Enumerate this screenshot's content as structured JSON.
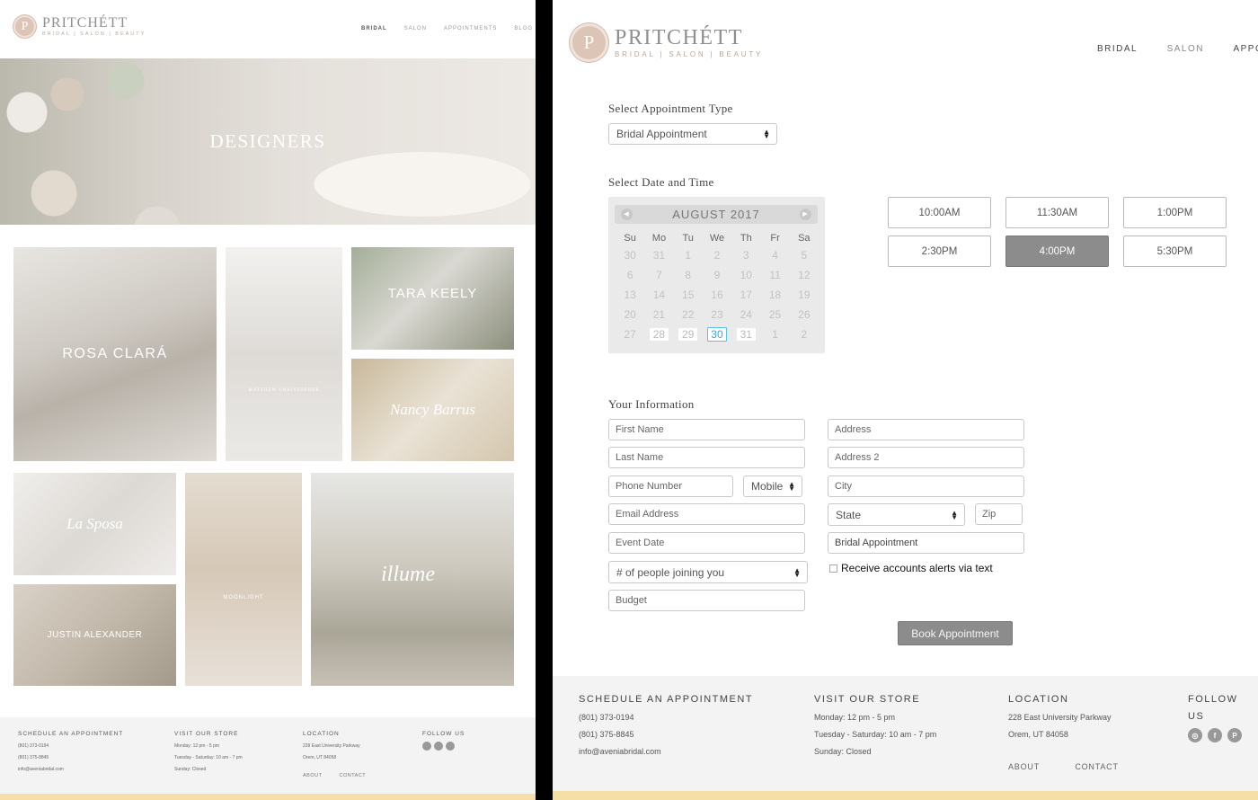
{
  "brand": {
    "monogram": "P",
    "name": "PRITCHÉTT",
    "tagline": "BRIDAL | SALON | BEAUTY"
  },
  "left": {
    "nav": [
      "BRIDAL",
      "SALON",
      "APPOINTMENTS",
      "BLOG"
    ],
    "hero_title": "DESIGNERS",
    "designers": [
      "ROSA CLARÁ",
      "MATTHEW CHRISTOPHER",
      "TARA KEELY",
      "Nancy Barrus",
      "La Sposa",
      "MOONLIGHT",
      "illume",
      "JUSTIN ALEXANDER"
    ],
    "footer": {
      "schedule_title": "SCHEDULE AN APPOINTMENT",
      "phone1": "(801) 373-0194",
      "phone2": "(801) 375-8845",
      "email": "info@aveniabridal.com",
      "store_title": "VISIT OUR STORE",
      "hours1": "Monday: 12 pm - 5 pm",
      "hours2": "Tuesday - Saturday: 10 am - 7 pm",
      "hours3": "Sunday: Closed",
      "location_title": "LOCATION",
      "address1": "228 East University Parkway",
      "address2": "Orem, UT 84058",
      "follow_title": "FOLLOW US",
      "about": "ABOUT",
      "contact": "CONTACT"
    }
  },
  "right": {
    "nav": [
      "BRIDAL",
      "SALON",
      "APPOINTMENTS"
    ],
    "appointment_type_heading": "Select Appointment Type",
    "appointment_type_value": "Bridal Appointment",
    "date_time_heading": "Select Date and Time",
    "calendar": {
      "month": "AUGUST 2017",
      "prev": "◀",
      "next": "▶",
      "dow": [
        "Su",
        "Mo",
        "Tu",
        "We",
        "Th",
        "Fr",
        "Sa"
      ],
      "weeks": [
        [
          "30",
          "31",
          "1",
          "2",
          "3",
          "4",
          "5"
        ],
        [
          "6",
          "7",
          "8",
          "9",
          "10",
          "11",
          "12"
        ],
        [
          "13",
          "14",
          "15",
          "16",
          "17",
          "18",
          "19"
        ],
        [
          "20",
          "21",
          "22",
          "23",
          "24",
          "25",
          "26"
        ],
        [
          "27",
          "28",
          "29",
          "30",
          "31",
          "1",
          "2"
        ]
      ],
      "selected_day": "30"
    },
    "time_slots": [
      "10:00AM",
      "11:30AM",
      "1:00PM",
      "2:30PM",
      "4:00PM",
      "5:30PM"
    ],
    "selected_slot": "4:00PM",
    "info_heading": "Your Information",
    "fields": {
      "first_name": "First Name",
      "last_name": "Last Name",
      "phone": "Phone Number",
      "phone_type": "Mobile",
      "email": "Email Address",
      "event_date": "Event Date",
      "people": "# of people joining you",
      "budget": "Budget",
      "address": "Address",
      "address2": "Address 2",
      "city": "City",
      "state": "State",
      "zip": "Zip",
      "appointment": "Bridal Appointment"
    },
    "alerts_label": "Receive accounts alerts via text",
    "book_button": "Book Appointment",
    "footer": {
      "schedule_title": "SCHEDULE AN APPOINTMENT",
      "phone1": "(801) 373-0194",
      "phone2": "(801) 375-8845",
      "email": "info@aveniabridal.com",
      "store_title": "VISIT OUR STORE",
      "hours1": "Monday: 12 pm - 5 pm",
      "hours2": "Tuesday - Saturday: 10 am - 7 pm",
      "hours3": "Sunday: Closed",
      "location_title": "LOCATION",
      "address1": "228 East University Parkway",
      "address2": "Orem, UT 84058",
      "follow_title": "FOLLOW US",
      "about": "ABOUT",
      "contact": "CONTACT"
    }
  },
  "colors": {
    "accent_gold": "#f5dfa6",
    "monogram": "#dcc5b6",
    "selected_slot": "#8c8c8c",
    "today_outline": "#5bc2e6"
  },
  "icons": [
    "instagram-icon",
    "facebook-icon",
    "pinterest-icon"
  ]
}
